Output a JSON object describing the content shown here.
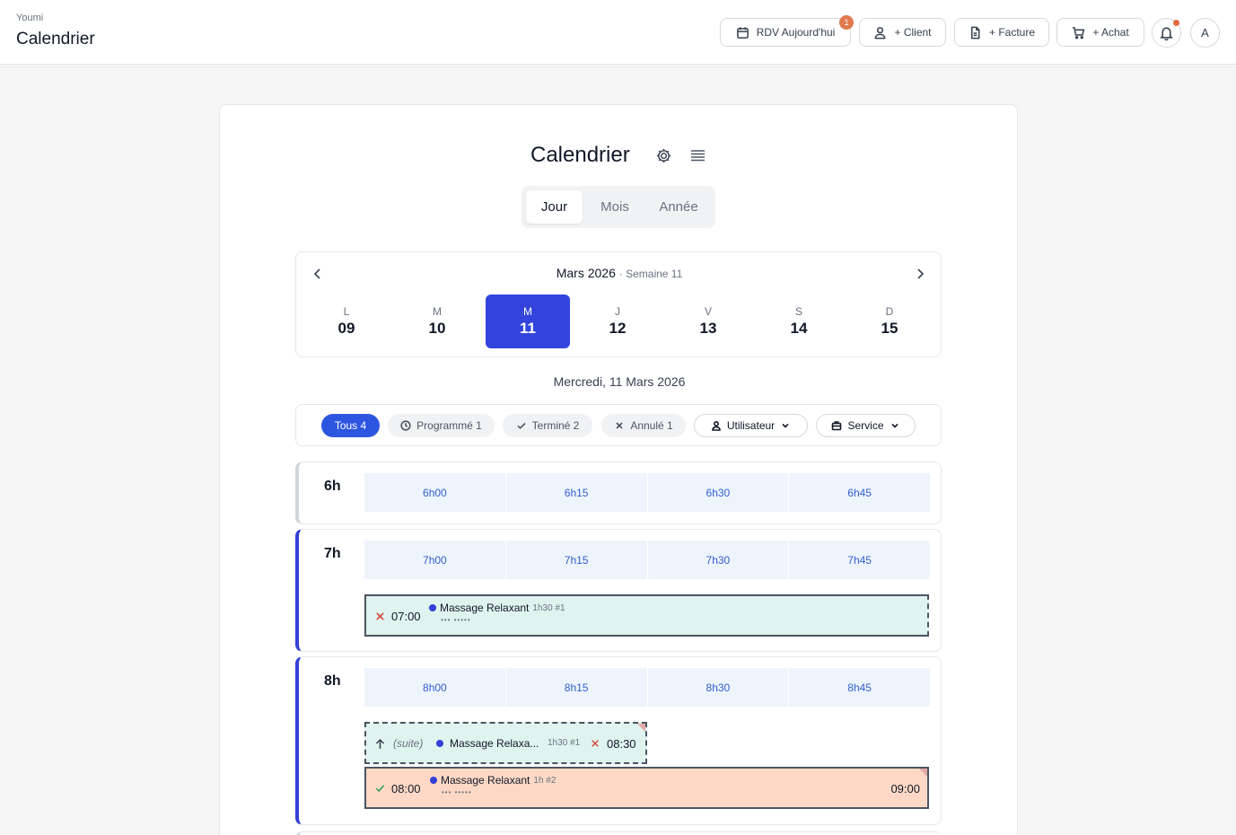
{
  "header": {
    "brand": "Youmi",
    "title": "Calendrier",
    "buttons": {
      "rdv": "RDV Aujourd'hui",
      "rdv_badge": "1",
      "client": "+ Client",
      "facture": "+ Facture",
      "achat": "+ Achat"
    },
    "avatar": "A"
  },
  "calendar": {
    "title": "Calendrier",
    "views": [
      "Jour",
      "Mois",
      "Année"
    ],
    "active_view": "Jour",
    "month": "Mars 2026",
    "week": "· Semaine 11",
    "days": [
      {
        "l": "L",
        "n": "09"
      },
      {
        "l": "M",
        "n": "10"
      },
      {
        "l": "M",
        "n": "11"
      },
      {
        "l": "J",
        "n": "12"
      },
      {
        "l": "V",
        "n": "13"
      },
      {
        "l": "S",
        "n": "14"
      },
      {
        "l": "D",
        "n": "15"
      }
    ],
    "selected_day": "11",
    "date_label": "Mercredi, 11 Mars 2026"
  },
  "filters": {
    "all": "Tous 4",
    "scheduled": "Programmé 1",
    "done": "Terminé 2",
    "cancelled": "Annulé 1",
    "user": "Utilisateur",
    "service": "Service"
  },
  "hours": [
    {
      "label": "6h",
      "slots": [
        "6h00",
        "6h15",
        "6h30",
        "6h45"
      ]
    },
    {
      "label": "7h",
      "slots": [
        "7h00",
        "7h15",
        "7h30",
        "7h45"
      ]
    },
    {
      "label": "8h",
      "slots": [
        "8h00",
        "8h15",
        "8h30",
        "8h45"
      ]
    }
  ],
  "appointments": {
    "a1": {
      "time": "07:00",
      "name": "Massage Relaxant",
      "meta": "1h30 #1",
      "stars": "••• •••••"
    },
    "a1b": {
      "suite": "(suite)",
      "name": "Massage Relaxa...",
      "meta": "1h30  #1",
      "end": "08:30"
    },
    "a2": {
      "time": "08:00",
      "name": "Massage Relaxant",
      "meta": "1h #2",
      "stars": "••• •••••",
      "end": "09:00"
    }
  },
  "colors": {
    "accent": "#3340d8",
    "chip_active": "#2d56e0",
    "teal": "#dff3ef",
    "salmon": "#fdd9c5"
  }
}
